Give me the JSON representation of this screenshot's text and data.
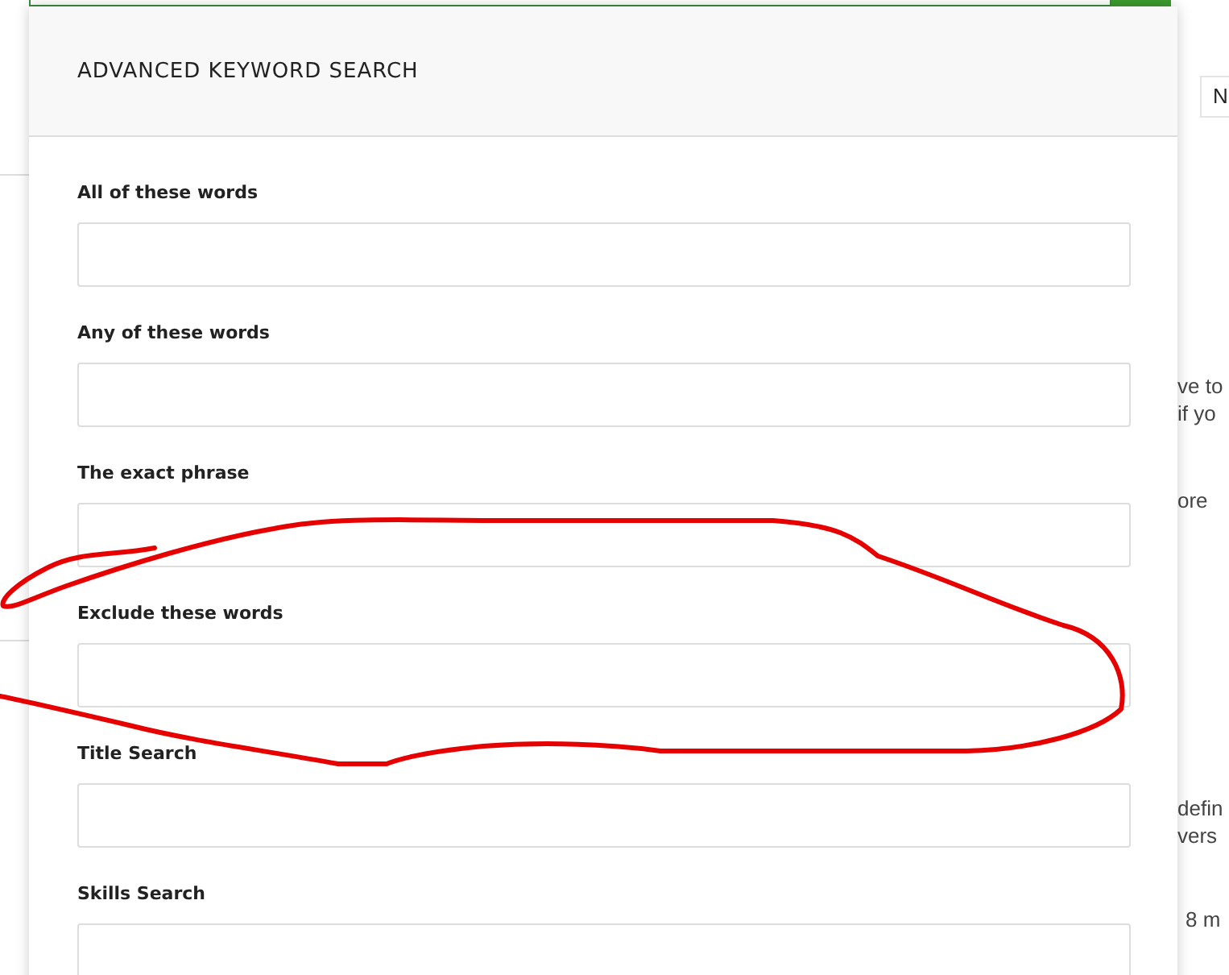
{
  "dialog": {
    "title": "ADVANCED KEYWORD SEARCH",
    "fields": [
      {
        "label": "All of these words"
      },
      {
        "label": "Any of these words"
      },
      {
        "label": "The exact phrase"
      },
      {
        "label": "Exclude these words"
      },
      {
        "label": "Title Search"
      },
      {
        "label": "Skills Search"
      }
    ]
  },
  "background": {
    "tab_text": "N",
    "snippets": [
      {
        "lines": [
          "ve to",
          "if yo"
        ]
      },
      {
        "lines": [
          "ore"
        ]
      },
      {
        "lines": [
          "defin",
          "vers"
        ]
      },
      {
        "lines": [
          "8 m"
        ]
      }
    ]
  },
  "annotation": {
    "kind": "freehand-loop"
  }
}
